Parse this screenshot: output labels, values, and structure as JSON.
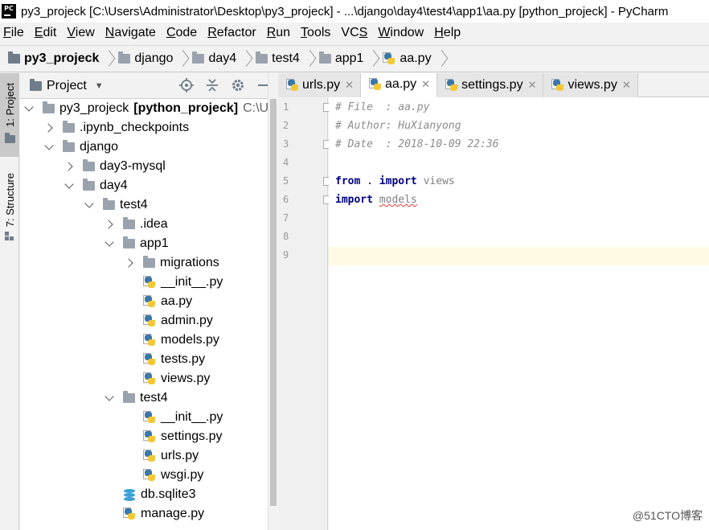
{
  "window": {
    "title": "py3_projeck [C:\\Users\\Administrator\\Desktop\\py3_projeck] - ...\\django\\day4\\test4\\app1\\aa.py [python_projeck] - PyCharm",
    "logo_text": "PC"
  },
  "menu": [
    {
      "u": "F",
      "rest": "ile"
    },
    {
      "u": "E",
      "rest": "dit"
    },
    {
      "u": "V",
      "rest": "iew"
    },
    {
      "u": "N",
      "rest": "avigate"
    },
    {
      "u": "C",
      "rest": "ode"
    },
    {
      "u": "R",
      "rest": "efactor"
    },
    {
      "u": "R",
      "rest": "un"
    },
    {
      "u": "T",
      "rest": "ools"
    },
    {
      "pre": "VC",
      "u": "S",
      "rest": ""
    },
    {
      "u": "W",
      "rest": "indow"
    },
    {
      "u": "H",
      "rest": "elp"
    }
  ],
  "breadcrumbs": [
    "py3_projeck",
    "django",
    "day4",
    "test4",
    "app1",
    "aa.py"
  ],
  "left_strip": {
    "project_tab": "1: Project",
    "structure_tab": "7: Structure"
  },
  "project_panel": {
    "title": "Project",
    "tree": [
      {
        "indent": 0,
        "arrow": "down",
        "icon": "folder",
        "label": "py3_projeck",
        "bold": "[python_projeck]",
        "hint": "C:\\Us"
      },
      {
        "indent": 1,
        "arrow": "right",
        "icon": "folder",
        "label": ".ipynb_checkpoints"
      },
      {
        "indent": 1,
        "arrow": "down",
        "icon": "folder",
        "label": "django"
      },
      {
        "indent": 2,
        "arrow": "right",
        "icon": "folder",
        "label": "day3-mysql"
      },
      {
        "indent": 2,
        "arrow": "down",
        "icon": "folder",
        "label": "day4"
      },
      {
        "indent": 3,
        "arrow": "down",
        "icon": "folder",
        "label": "test4"
      },
      {
        "indent": 4,
        "arrow": "right",
        "icon": "folder",
        "label": ".idea"
      },
      {
        "indent": 4,
        "arrow": "down",
        "icon": "folder",
        "label": "app1"
      },
      {
        "indent": 5,
        "arrow": "right",
        "icon": "folder",
        "label": "migrations"
      },
      {
        "indent": 5,
        "arrow": "",
        "icon": "py",
        "label": "__init__.py"
      },
      {
        "indent": 5,
        "arrow": "",
        "icon": "py",
        "label": "aa.py"
      },
      {
        "indent": 5,
        "arrow": "",
        "icon": "py",
        "label": "admin.py"
      },
      {
        "indent": 5,
        "arrow": "",
        "icon": "py",
        "label": "models.py"
      },
      {
        "indent": 5,
        "arrow": "",
        "icon": "py",
        "label": "tests.py"
      },
      {
        "indent": 5,
        "arrow": "",
        "icon": "py",
        "label": "views.py"
      },
      {
        "indent": 4,
        "arrow": "down",
        "icon": "folder",
        "label": "test4"
      },
      {
        "indent": 5,
        "arrow": "",
        "icon": "py",
        "label": "__init__.py"
      },
      {
        "indent": 5,
        "arrow": "",
        "icon": "py",
        "label": "settings.py"
      },
      {
        "indent": 5,
        "arrow": "",
        "icon": "py",
        "label": "urls.py"
      },
      {
        "indent": 5,
        "arrow": "",
        "icon": "py",
        "label": "wsgi.py"
      },
      {
        "indent": 4,
        "arrow": "",
        "icon": "db",
        "label": "db.sqlite3"
      },
      {
        "indent": 4,
        "arrow": "",
        "icon": "py",
        "label": "manage.py"
      }
    ]
  },
  "editor_tabs": [
    {
      "label": "urls.py",
      "active": false
    },
    {
      "label": "aa.py",
      "active": true
    },
    {
      "label": "settings.py",
      "active": false
    },
    {
      "label": "views.py",
      "active": false
    }
  ],
  "code": {
    "line_numbers": [
      "1",
      "2",
      "3",
      "4",
      "5",
      "6",
      "7",
      "8",
      "9"
    ],
    "lines": [
      {
        "parts": [
          {
            "cls": "comment",
            "t": "# File  : aa.py"
          }
        ]
      },
      {
        "parts": [
          {
            "cls": "comment",
            "t": "# Author: HuXianyong"
          }
        ]
      },
      {
        "parts": [
          {
            "cls": "comment",
            "t": "# Date  : 2018-10-09 22:36"
          }
        ]
      },
      {
        "parts": []
      },
      {
        "parts": [
          {
            "cls": "kw",
            "t": "from"
          },
          {
            "cls": "ident",
            "t": " . "
          },
          {
            "cls": "kw",
            "t": "import"
          },
          {
            "cls": "unused",
            "t": " views"
          }
        ]
      },
      {
        "parts": [
          {
            "cls": "kw",
            "t": "import"
          },
          {
            "cls": "ident",
            "t": " "
          },
          {
            "cls": "unused squiggle",
            "t": "models"
          }
        ]
      },
      {
        "parts": []
      },
      {
        "parts": []
      },
      {
        "parts": []
      }
    ],
    "current_line": 9
  },
  "watermark": "@51CTO博客"
}
